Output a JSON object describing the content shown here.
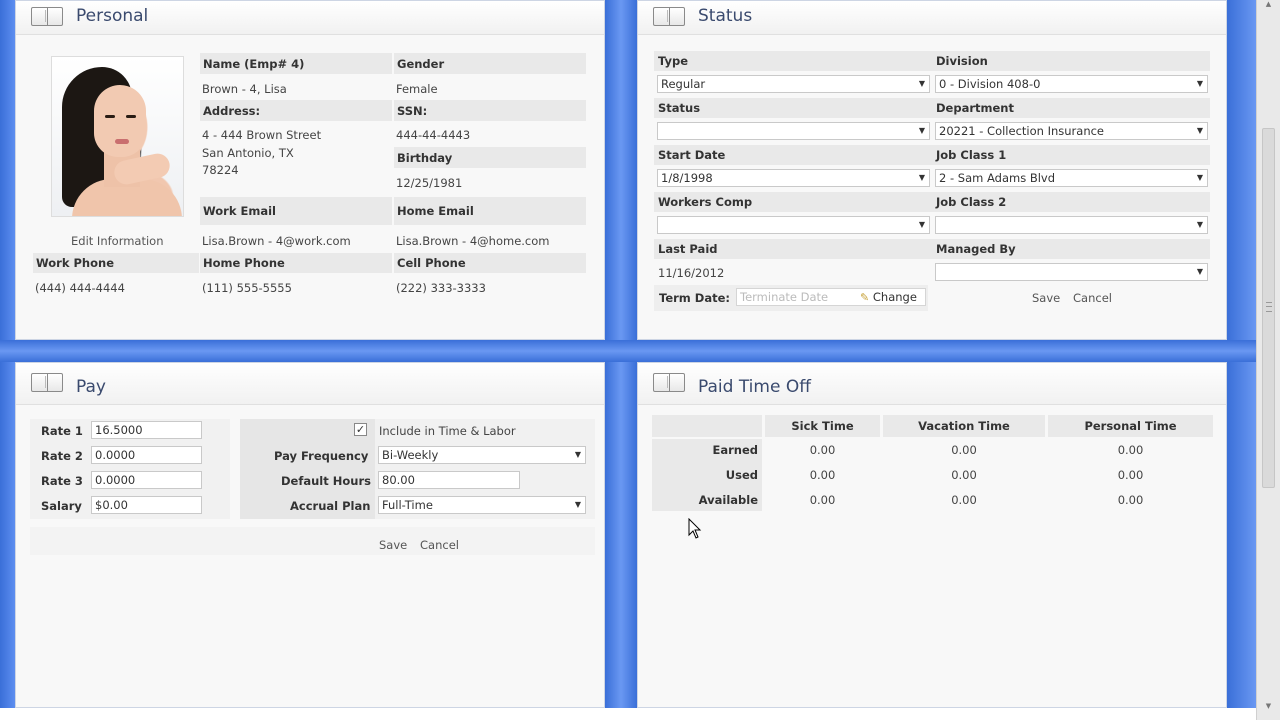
{
  "personal": {
    "title": "Personal",
    "edit_link": "Edit Information",
    "name_label": "Name (Emp# 4)",
    "name_value": "Brown - 4, Lisa",
    "gender_label": "Gender",
    "gender_value": "Female",
    "address_label": "Address:",
    "address_line1": "4 - 444 Brown Street",
    "address_line2": "San Antonio, TX",
    "address_line3": "78224",
    "ssn_label": "SSN:",
    "ssn_value": "444-44-4443",
    "birthday_label": "Birthday",
    "birthday_value": "12/25/1981",
    "work_email_label": "Work Email",
    "work_email_value": "Lisa.Brown - 4@work.com",
    "home_email_label": "Home Email",
    "home_email_value": "Lisa.Brown - 4@home.com",
    "work_phone_label": "Work Phone",
    "work_phone_value": "(444) 444-4444",
    "home_phone_label": "Home Phone",
    "home_phone_value": "(111) 555-5555",
    "cell_phone_label": "Cell Phone",
    "cell_phone_value": "(222) 333-3333"
  },
  "status": {
    "title": "Status",
    "type_label": "Type",
    "type_value": "Regular",
    "division_label": "Division",
    "division_value": "0 - Division 408-0",
    "status_label": "Status",
    "status_value": "",
    "department_label": "Department",
    "department_value": "20221 - Collection Insurance",
    "start_date_label": "Start Date",
    "start_date_value": "1/8/1998",
    "job_class1_label": "Job Class 1",
    "job_class1_value": "2 - Sam Adams Blvd",
    "workers_comp_label": "Workers Comp",
    "workers_comp_value": "",
    "job_class2_label": "Job Class 2",
    "job_class2_value": "",
    "last_paid_label": "Last Paid",
    "last_paid_value": "11/16/2012",
    "managed_by_label": "Managed By",
    "managed_by_value": "",
    "term_date_label": "Term Date:",
    "term_date_placeholder": "Terminate Date",
    "change_label": "Change",
    "save_label": "Save",
    "cancel_label": "Cancel"
  },
  "pay": {
    "title": "Pay",
    "rate1_label": "Rate 1",
    "rate1_value": "16.5000",
    "rate2_label": "Rate 2",
    "rate2_value": "0.0000",
    "rate3_label": "Rate 3",
    "rate3_value": "0.0000",
    "salary_label": "Salary",
    "salary_value": "$0.00",
    "include_label": "Include in Time & Labor",
    "include_checked": true,
    "pay_frequency_label": "Pay Frequency",
    "pay_frequency_value": "Bi-Weekly",
    "default_hours_label": "Default Hours",
    "default_hours_value": "80.00",
    "accrual_plan_label": "Accrual Plan",
    "accrual_plan_value": "Full-Time",
    "save_label": "Save",
    "cancel_label": "Cancel"
  },
  "pto": {
    "title": "Paid Time Off",
    "columns": [
      "Sick Time",
      "Vacation Time",
      "Personal Time"
    ],
    "rows": [
      {
        "label": "Earned",
        "values": [
          "0.00",
          "0.00",
          "0.00"
        ]
      },
      {
        "label": "Used",
        "values": [
          "0.00",
          "0.00",
          "0.00"
        ]
      },
      {
        "label": "Available",
        "values": [
          "0.00",
          "0.00",
          "0.00"
        ]
      }
    ]
  },
  "colors": {
    "background_blue": "#4d7fe0",
    "panel_bg": "#f8f8f8",
    "title_text": "#3a4a6e"
  },
  "icons": {
    "panel_icon": "book-icon",
    "dropdown": "chevron-down-icon",
    "change_icon": "pencil-icon",
    "cursor": "mouse-pointer-icon"
  }
}
